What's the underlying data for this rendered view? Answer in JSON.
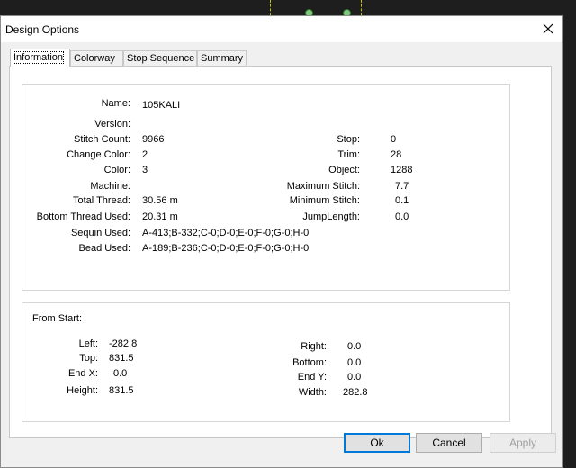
{
  "window": {
    "title": "Design Options"
  },
  "tabs": [
    {
      "label": "Information"
    },
    {
      "label": "Colorway"
    },
    {
      "label": "Stop Sequence"
    },
    {
      "label": "Summary"
    }
  ],
  "info": {
    "name_label": "Name:",
    "name_value": "105KALI",
    "version_label": "Version:",
    "version_value": "",
    "stitch_count_label": "Stitch Count:",
    "stitch_count_value": "9966",
    "change_color_label": "Change Color:",
    "change_color_value": "2",
    "color_label": "Color:",
    "color_value": "3",
    "machine_label": "Machine:",
    "machine_value": "",
    "total_thread_label": "Total Thread:",
    "total_thread_value": "30.56 m",
    "bottom_thread_label": "Bottom Thread Used:",
    "bottom_thread_value": "20.31 m",
    "sequin_label": "Sequin Used:",
    "sequin_value": "A-413;B-332;C-0;D-0;E-0;F-0;G-0;H-0",
    "bead_label": "Bead Used:",
    "bead_value": "A-189;B-236;C-0;D-0;E-0;F-0;G-0;H-0",
    "stop_label": "Stop:",
    "stop_value": "0",
    "trim_label": "Trim:",
    "trim_value": "28",
    "object_label": "Object:",
    "object_value": "1288",
    "max_stitch_label": "Maximum Stitch:",
    "max_stitch_value": "7.7",
    "min_stitch_label": "Minimum Stitch:",
    "min_stitch_value": "0.1",
    "jump_length_label": "JumpLength:",
    "jump_length_value": "0.0"
  },
  "from_start": {
    "heading": "From Start:",
    "left_label": "Left:",
    "left_value": "-282.8",
    "top_label": "Top:",
    "top_value": "831.5",
    "endx_label": "End X:",
    "endx_value": "0.0",
    "height_label": "Height:",
    "height_value": "831.5",
    "right_label": "Right:",
    "right_value": "0.0",
    "bottom_label": "Bottom:",
    "bottom_value": "0.0",
    "endy_label": "End Y:",
    "endy_value": "0.0",
    "width_label": "Width:",
    "width_value": "282.8"
  },
  "buttons": {
    "ok": "Ok",
    "cancel": "Cancel",
    "apply": "Apply"
  },
  "icons": {
    "close": "close-icon"
  },
  "colors": {
    "accent": "#0078d7",
    "background": "#1e1e1e",
    "dialog": "#f0f0f0"
  }
}
